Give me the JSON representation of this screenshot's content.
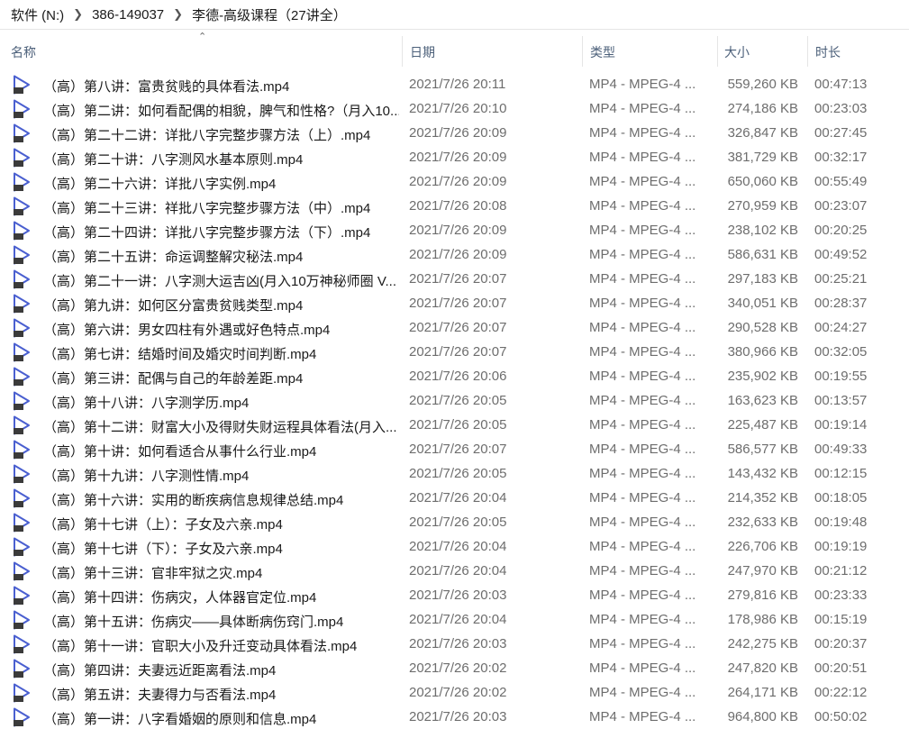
{
  "breadcrumb": [
    "软件 (N:)",
    "386-149037",
    "李德-高级课程（27讲全）"
  ],
  "columns": {
    "name": "名称",
    "date": "日期",
    "type": "类型",
    "size": "大小",
    "duration": "时长"
  },
  "colors": {
    "icon_accent": "#4a5fd0",
    "header_text": "#4c607a"
  },
  "files": [
    {
      "name": "（高）第八讲：富贵贫贱的具体看法.mp4",
      "date": "2021/7/26 20:11",
      "type": "MP4 - MPEG-4 ...",
      "size": "559,260 KB",
      "duration": "00:47:13"
    },
    {
      "name": "（高）第二讲：如何看配偶的相貌，脾气和性格?（月入10...",
      "date": "2021/7/26 20:10",
      "type": "MP4 - MPEG-4 ...",
      "size": "274,186 KB",
      "duration": "00:23:03"
    },
    {
      "name": "（高）第二十二讲：详批八字完整步骤方法（上）.mp4",
      "date": "2021/7/26 20:09",
      "type": "MP4 - MPEG-4 ...",
      "size": "326,847 KB",
      "duration": "00:27:45"
    },
    {
      "name": "（高）第二十讲：八字测风水基本原则.mp4",
      "date": "2021/7/26 20:09",
      "type": "MP4 - MPEG-4 ...",
      "size": "381,729 KB",
      "duration": "00:32:17"
    },
    {
      "name": "（高）第二十六讲：详批八字实例.mp4",
      "date": "2021/7/26 20:09",
      "type": "MP4 - MPEG-4 ...",
      "size": "650,060 KB",
      "duration": "00:55:49"
    },
    {
      "name": "（高）第二十三讲：祥批八字完整步骤方法（中）.mp4",
      "date": "2021/7/26 20:08",
      "type": "MP4 - MPEG-4 ...",
      "size": "270,959 KB",
      "duration": "00:23:07"
    },
    {
      "name": "（高）第二十四讲：详批八字完整步骤方法（下）.mp4",
      "date": "2021/7/26 20:09",
      "type": "MP4 - MPEG-4 ...",
      "size": "238,102 KB",
      "duration": "00:20:25"
    },
    {
      "name": "（高）第二十五讲：命运调整解灾秘法.mp4",
      "date": "2021/7/26 20:09",
      "type": "MP4 - MPEG-4 ...",
      "size": "586,631 KB",
      "duration": "00:49:52"
    },
    {
      "name": "（高）第二十一讲：八字测大运吉凶(月入10万神秘师圈 V...",
      "date": "2021/7/26 20:07",
      "type": "MP4 - MPEG-4 ...",
      "size": "297,183 KB",
      "duration": "00:25:21"
    },
    {
      "name": "（高）第九讲：如何区分富贵贫贱类型.mp4",
      "date": "2021/7/26 20:07",
      "type": "MP4 - MPEG-4 ...",
      "size": "340,051 KB",
      "duration": "00:28:37"
    },
    {
      "name": "（高）第六讲：男女四柱有外遇或好色特点.mp4",
      "date": "2021/7/26 20:07",
      "type": "MP4 - MPEG-4 ...",
      "size": "290,528 KB",
      "duration": "00:24:27"
    },
    {
      "name": "（高）第七讲：结婚时间及婚灾时间判断.mp4",
      "date": "2021/7/26 20:07",
      "type": "MP4 - MPEG-4 ...",
      "size": "380,966 KB",
      "duration": "00:32:05"
    },
    {
      "name": "（高）第三讲：配偶与自己的年龄差距.mp4",
      "date": "2021/7/26 20:06",
      "type": "MP4 - MPEG-4 ...",
      "size": "235,902 KB",
      "duration": "00:19:55"
    },
    {
      "name": "（高）第十八讲：八字测学历.mp4",
      "date": "2021/7/26 20:05",
      "type": "MP4 - MPEG-4 ...",
      "size": "163,623 KB",
      "duration": "00:13:57"
    },
    {
      "name": "（高）第十二讲：财富大小及得财失财运程具体看法(月入...",
      "date": "2021/7/26 20:05",
      "type": "MP4 - MPEG-4 ...",
      "size": "225,487 KB",
      "duration": "00:19:14"
    },
    {
      "name": "（高）第十讲：如何看适合从事什么行业.mp4",
      "date": "2021/7/26 20:07",
      "type": "MP4 - MPEG-4 ...",
      "size": "586,577 KB",
      "duration": "00:49:33"
    },
    {
      "name": "（高）第十九讲：八字测性情.mp4",
      "date": "2021/7/26 20:05",
      "type": "MP4 - MPEG-4 ...",
      "size": "143,432 KB",
      "duration": "00:12:15"
    },
    {
      "name": "（高）第十六讲：实用的断疾病信息规律总结.mp4",
      "date": "2021/7/26 20:04",
      "type": "MP4 - MPEG-4 ...",
      "size": "214,352 KB",
      "duration": "00:18:05"
    },
    {
      "name": "（高）第十七讲（上）：子女及六亲.mp4",
      "date": "2021/7/26 20:05",
      "type": "MP4 - MPEG-4 ...",
      "size": "232,633 KB",
      "duration": "00:19:48"
    },
    {
      "name": "（高）第十七讲（下）：子女及六亲.mp4",
      "date": "2021/7/26 20:04",
      "type": "MP4 - MPEG-4 ...",
      "size": "226,706 KB",
      "duration": "00:19:19"
    },
    {
      "name": "（高）第十三讲：官非牢狱之灾.mp4",
      "date": "2021/7/26 20:04",
      "type": "MP4 - MPEG-4 ...",
      "size": "247,970 KB",
      "duration": "00:21:12"
    },
    {
      "name": "（高）第十四讲：伤病灾，人体器官定位.mp4",
      "date": "2021/7/26 20:03",
      "type": "MP4 - MPEG-4 ...",
      "size": "279,816 KB",
      "duration": "00:23:33"
    },
    {
      "name": "（高）第十五讲：伤病灾——具体断病伤窍门.mp4",
      "date": "2021/7/26 20:04",
      "type": "MP4 - MPEG-4 ...",
      "size": "178,986 KB",
      "duration": "00:15:19"
    },
    {
      "name": "（高）第十一讲：官职大小及升迁变动具体看法.mp4",
      "date": "2021/7/26 20:03",
      "type": "MP4 - MPEG-4 ...",
      "size": "242,275 KB",
      "duration": "00:20:37"
    },
    {
      "name": "（高）第四讲：夫妻远近距离看法.mp4",
      "date": "2021/7/26 20:02",
      "type": "MP4 - MPEG-4 ...",
      "size": "247,820 KB",
      "duration": "00:20:51"
    },
    {
      "name": "（高）第五讲：夫妻得力与否看法.mp4",
      "date": "2021/7/26 20:02",
      "type": "MP4 - MPEG-4 ...",
      "size": "264,171 KB",
      "duration": "00:22:12"
    },
    {
      "name": "（高）第一讲：八字看婚姻的原则和信息.mp4",
      "date": "2021/7/26 20:03",
      "type": "MP4 - MPEG-4 ...",
      "size": "964,800 KB",
      "duration": "00:50:02"
    }
  ]
}
